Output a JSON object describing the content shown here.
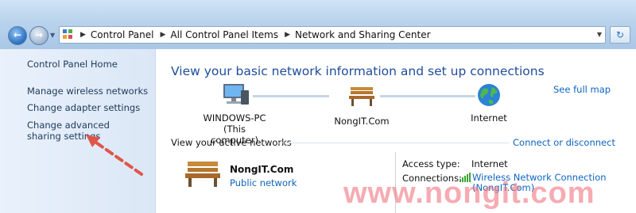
{
  "breadcrumb": {
    "items": [
      "Control Panel",
      "All Control Panel Items",
      "Network and Sharing Center"
    ]
  },
  "sidebar": {
    "home": "Control Panel Home",
    "links": [
      "Manage wireless networks",
      "Change adapter settings",
      "Change advanced sharing settings"
    ]
  },
  "main": {
    "title": "View your basic network information and set up connections",
    "see_full_map": "See full map",
    "map": {
      "computer_name": "WINDOWS-PC",
      "computer_note": "(This computer)",
      "network_name": "NongIT.Com",
      "internet": "Internet"
    },
    "active_networks_label": "View your active networks",
    "connect_link": "Connect or disconnect",
    "active_network": {
      "name": "NongIT.Com",
      "type": "Public network",
      "access_type_label": "Access type:",
      "access_type_value": "Internet",
      "connections_label": "Connections:",
      "connection_link_line1": "Wireless Network Connection",
      "connection_link_line2": "(NongIT.Com)"
    }
  },
  "watermark": "www.nongit.com",
  "colors": {
    "link": "#0d64c0",
    "title": "#1e4d9a",
    "sidebar_link": "#1e395b",
    "annotation_arrow": "#e0554a",
    "watermark": "#f07882"
  },
  "icons": [
    "back-arrow-icon",
    "forward-arrow-icon",
    "control-panel-icon",
    "refresh-icon",
    "computer-icon",
    "bench-icon",
    "globe-icon",
    "signal-bars-icon"
  ]
}
